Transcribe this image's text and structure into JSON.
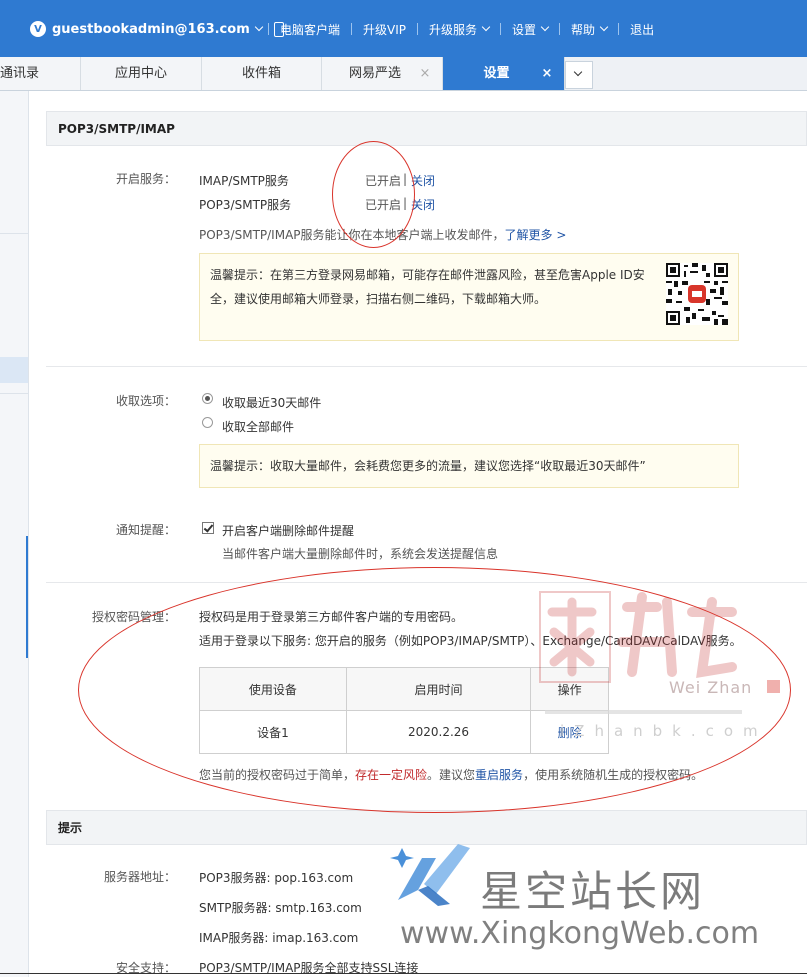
{
  "topbar": {
    "account": "guestbookadmin@163.com",
    "nav": [
      "电脑客户端",
      "升级VIP",
      "升级服务",
      "设置",
      "帮助",
      "退出"
    ]
  },
  "tabs": [
    {
      "label": "通讯录"
    },
    {
      "label": "应用中心"
    },
    {
      "label": "收件箱"
    },
    {
      "label": "网易严选",
      "close": "×"
    },
    {
      "label": "设置",
      "close": "×",
      "active": true
    }
  ],
  "pop": {
    "heading": "POP3/SMTP/IMAP",
    "service_label": "开启服务：",
    "services": [
      {
        "name": "IMAP/SMTP服务",
        "status": "已开启",
        "action": "关闭"
      },
      {
        "name": "POP3/SMTP服务",
        "status": "已开启",
        "action": "关闭"
      }
    ],
    "separator": "|",
    "desc": "POP3/SMTP/IMAP服务能让你在本地客户端上收发邮件，",
    "learn_more": "了解更多 >",
    "tip1_line1": "温馨提示：在第三方登录网易邮箱，可能存在邮件泄露风险，甚至危害Apple ID安",
    "tip1_line2": "全，建议使用邮箱大师登录，扫描右侧二维码，下载邮箱大师。",
    "fetch_label": "收取选项：",
    "fetch_options": [
      "收取最近30天邮件",
      "收取全部邮件"
    ],
    "tip2": "温馨提示：收取大量邮件，会耗费您更多的流量，建议您选择“收取最近30天邮件”",
    "notify_label": "通知提醒：",
    "notify_option": "开启客户端删除邮件提醒",
    "notify_desc": "当邮件客户端大量删除邮件时，系统会发送提醒信息",
    "auth_label": "授权密码管理：",
    "auth_line1": "授权码是用于登录第三方邮件客户端的专用密码。",
    "auth_line2": "适用于登录以下服务: 您开启的服务（例如POP3/IMAP/SMTP）、Exchange/CardDAV/CalDAV服务。",
    "table_headers": [
      "使用设备",
      "启用时间",
      "操作"
    ],
    "table_rows": [
      [
        "设备1",
        "2020.2.26",
        "删除"
      ]
    ],
    "warn_pre": "您当前的授权密码过于简单，",
    "warn_risk": "存在一定风险",
    "warn_mid": "。建议您",
    "warn_restart": "重启服务",
    "warn_post": "，使用系统随机生成的授权密码。"
  },
  "tips": {
    "heading": "提示",
    "server_label": "服务器地址：",
    "servers": [
      "POP3服务器: pop.163.com",
      "SMTP服务器: smtp.163.com",
      "IMAP服务器: imap.163.com"
    ],
    "security_label": "安全支持：",
    "security_value": "POP3/SMTP/IMAP服务全部支持SSL连接"
  },
  "watermarks": {
    "wz_brand": "Wei Zhan",
    "wz_url": "iZhanbk.com",
    "xk_title": "星空站长网",
    "xk_url": "www.XingkongWeb.com"
  },
  "colors": {
    "brand": "#2f7ad1",
    "link": "#2155a6",
    "warn": "#c0282a",
    "annotation": "#d9342b"
  }
}
